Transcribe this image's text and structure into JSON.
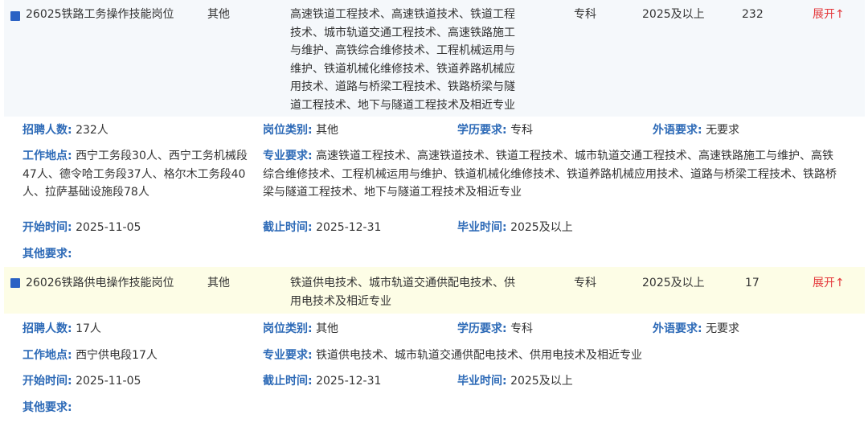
{
  "jobs": [
    {
      "title": "26025铁路工务操作技能岗位",
      "category": "其他",
      "majors": "高速铁道工程技术、高速铁道技术、铁道工程技术、城市轨道交通工程技术、高速铁路施工与维护、高铁综合维修技术、工程机械运用与维护、铁道机械化维修技术、铁道养路机械应用技术、道路与桥梁工程技术、铁路桥梁与隧道工程技术、地下与隧道工程技术及相近专业",
      "education": "专科",
      "graduation": "2025及以上",
      "count": "232",
      "toggle": "展开↑",
      "detail": {
        "recruit_label": "招聘人数:",
        "recruit_value": "232人",
        "category_label": "岗位类别:",
        "category_value": "其他",
        "education_label": "学历要求:",
        "education_value": "专科",
        "language_label": "外语要求:",
        "language_value": "无要求",
        "location_label": "工作地点:",
        "location_value": "西宁工务段30人、西宁工务机械段47人、德令哈工务段37人、格尔木工务段40人、拉萨基础设施段78人",
        "major_label": "专业要求:",
        "major_value": "高速铁道工程技术、高速铁道技术、铁道工程技术、城市轨道交通工程技术、高速铁路施工与维护、高铁综合维修技术、工程机械运用与维护、铁道机械化维修技术、铁道养路机械应用技术、道路与桥梁工程技术、铁路桥梁与隧道工程技术、地下与隧道工程技术及相近专业",
        "start_label": "开始时间:",
        "start_value": "2025-11-05",
        "end_label": "截止时间:",
        "end_value": "2025-12-31",
        "grad_label": "毕业时间:",
        "grad_value": "2025及以上",
        "other_label": "其他要求:"
      }
    },
    {
      "title": "26026铁路供电操作技能岗位",
      "category": "其他",
      "majors": "铁道供电技术、城市轨道交通供配电技术、供用电技术及相近专业",
      "education": "专科",
      "graduation": "2025及以上",
      "count": "17",
      "toggle": "展开↑",
      "detail": {
        "recruit_label": "招聘人数:",
        "recruit_value": "17人",
        "category_label": "岗位类别:",
        "category_value": "其他",
        "education_label": "学历要求:",
        "education_value": "专科",
        "language_label": "外语要求:",
        "language_value": "无要求",
        "location_label": "工作地点:",
        "location_value": "西宁供电段17人",
        "major_label": "专业要求:",
        "major_value": "铁道供电技术、城市轨道交通供配电技术、供用电技术及相近专业",
        "start_label": "开始时间:",
        "start_value": "2025-11-05",
        "end_label": "截止时间:",
        "end_value": "2025-12-31",
        "grad_label": "毕业时间:",
        "grad_value": "2025及以上",
        "other_label": "其他要求:"
      }
    }
  ]
}
